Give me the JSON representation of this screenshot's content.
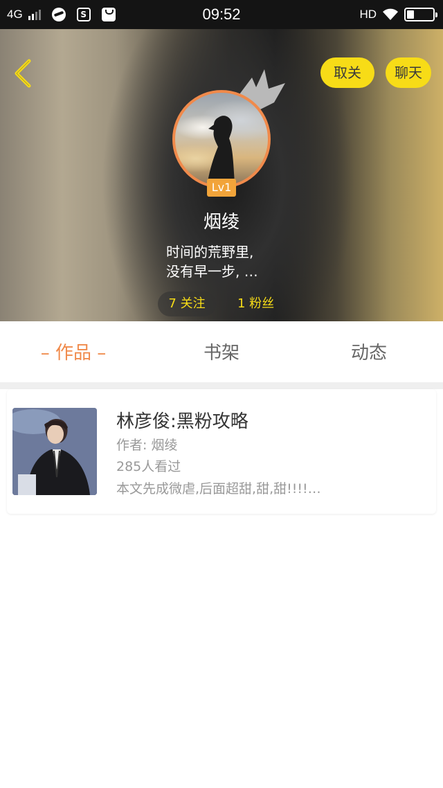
{
  "status_bar": {
    "network": "4G",
    "time": "09:52",
    "hd": "HD"
  },
  "header": {
    "unfollow_label": "取关",
    "chat_label": "聊天",
    "level": "Lv1",
    "username": "烟绫",
    "bio_line1": "时间的荒野里,",
    "bio_line2": "没有早一步, …",
    "following": "7 关注",
    "fans": "1 粉丝",
    "accent_color": "#f7dc17"
  },
  "tabs": {
    "works": "– 作品 –",
    "bookshelf": "书架",
    "feed": "动态",
    "active_color": "#f08a4b"
  },
  "works": [
    {
      "title": "林彦俊:黑粉攻略",
      "author": "作者: 烟绫",
      "views": "285人看过",
      "summary": "本文先成微虐,后面超甜,甜,甜!!!!…"
    }
  ]
}
